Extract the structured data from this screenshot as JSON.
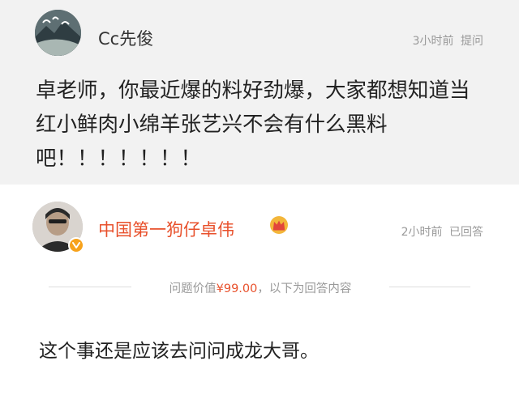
{
  "question": {
    "author_name": "Cc先俊",
    "time_ago": "3小时前",
    "action": "提问",
    "text": "卓老师，你最近爆的料好劲爆，大家都想知道当红小鲜肉小绵羊张艺兴不会有什么黑料吧！！！！！！！"
  },
  "answer": {
    "author_name": "中国第一狗仔卓伟",
    "time_ago": "2小时前",
    "status": "已回答",
    "price_prefix": "问题价值",
    "price_value": "¥99.00",
    "price_suffix": "，以下为回答内容",
    "text": "这个事还是应该去问问成龙大哥。"
  },
  "icons": {
    "question_avatar": "avatar-landscape-icon",
    "answer_avatar": "avatar-portrait-icon",
    "verified_badge": "verified-v-icon",
    "crown": "crown-icon"
  },
  "colors": {
    "accent": "#e8502b",
    "badge": "#f7a21b",
    "question_bg": "#f2f2f2",
    "meta_text": "#9a9a9a"
  }
}
